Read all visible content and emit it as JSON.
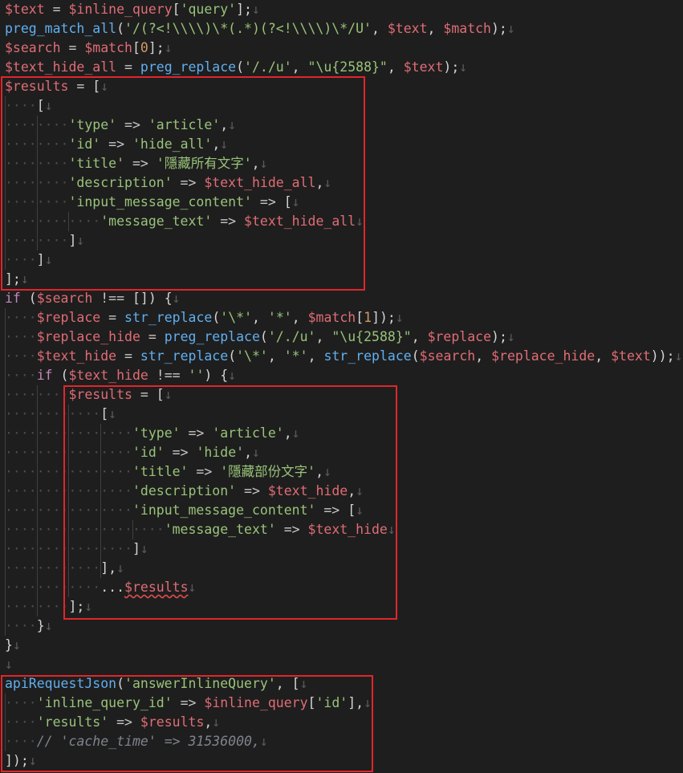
{
  "editor": {
    "whitespace_glyph": "·",
    "eol_glyph": "↓",
    "lines": [
      [
        [
          "var",
          "$text"
        ],
        [
          "op",
          " = "
        ],
        [
          "var",
          "$inline_query"
        ],
        [
          "pun",
          "["
        ],
        [
          "str",
          "'query'"
        ],
        [
          "pun",
          "];"
        ]
      ],
      [
        [
          "fn",
          "preg_match_all"
        ],
        [
          "pun",
          "("
        ],
        [
          "str",
          "'/(?<!\\\\\\\\)\\*(.*)(?<!\\\\\\\\)\\*/U'"
        ],
        [
          "pun",
          ", "
        ],
        [
          "var",
          "$text"
        ],
        [
          "pun",
          ", "
        ],
        [
          "var",
          "$match"
        ],
        [
          "pun",
          ");"
        ]
      ],
      [
        [
          "var",
          "$search"
        ],
        [
          "op",
          " = "
        ],
        [
          "var",
          "$match"
        ],
        [
          "pun",
          "["
        ],
        [
          "num",
          "0"
        ],
        [
          "pun",
          "];"
        ]
      ],
      [
        [
          "var",
          "$text_hide_all"
        ],
        [
          "op",
          " = "
        ],
        [
          "fn",
          "preg_replace"
        ],
        [
          "pun",
          "("
        ],
        [
          "str",
          "'/./u'"
        ],
        [
          "pun",
          ", "
        ],
        [
          "str",
          "\"\\u{2588}\""
        ],
        [
          "pun",
          ", "
        ],
        [
          "var",
          "$text"
        ],
        [
          "pun",
          ");"
        ]
      ],
      [
        [
          "var",
          "$results"
        ],
        [
          "op",
          " = "
        ],
        [
          "pun",
          "["
        ]
      ],
      [
        [
          "ws",
          "····"
        ],
        [
          "pun",
          "["
        ]
      ],
      [
        [
          "ws",
          "········"
        ],
        [
          "str",
          "'type'"
        ],
        [
          "op",
          " => "
        ],
        [
          "str",
          "'article'"
        ],
        [
          "pun",
          ","
        ]
      ],
      [
        [
          "ws",
          "········"
        ],
        [
          "str",
          "'id'"
        ],
        [
          "op",
          " => "
        ],
        [
          "str",
          "'hide_all'"
        ],
        [
          "pun",
          ","
        ]
      ],
      [
        [
          "ws",
          "········"
        ],
        [
          "str",
          "'title'"
        ],
        [
          "op",
          " => "
        ],
        [
          "str",
          "'隱藏所有文字'"
        ],
        [
          "pun",
          ","
        ]
      ],
      [
        [
          "ws",
          "········"
        ],
        [
          "str",
          "'description'"
        ],
        [
          "op",
          " => "
        ],
        [
          "var",
          "$text_hide_all"
        ],
        [
          "pun",
          ","
        ]
      ],
      [
        [
          "ws",
          "········"
        ],
        [
          "str",
          "'input_message_content'"
        ],
        [
          "op",
          " => "
        ],
        [
          "pun",
          "["
        ]
      ],
      [
        [
          "ws",
          "············"
        ],
        [
          "str",
          "'message_text'"
        ],
        [
          "op",
          " => "
        ],
        [
          "var",
          "$text_hide_all"
        ]
      ],
      [
        [
          "ws",
          "········"
        ],
        [
          "pun",
          "]"
        ]
      ],
      [
        [
          "ws",
          "····"
        ],
        [
          "pun",
          "]"
        ]
      ],
      [
        [
          "pun",
          "];"
        ]
      ],
      [
        [
          "kw",
          "if"
        ],
        [
          "pun",
          " ("
        ],
        [
          "var",
          "$search"
        ],
        [
          "op",
          " !== "
        ],
        [
          "pun",
          "[]) {"
        ]
      ],
      [
        [
          "ws",
          "····"
        ],
        [
          "var",
          "$replace"
        ],
        [
          "op",
          " = "
        ],
        [
          "fn",
          "str_replace"
        ],
        [
          "pun",
          "("
        ],
        [
          "str",
          "'\\*'"
        ],
        [
          "pun",
          ", "
        ],
        [
          "str",
          "'*'"
        ],
        [
          "pun",
          ", "
        ],
        [
          "var",
          "$match"
        ],
        [
          "pun",
          "["
        ],
        [
          "num",
          "1"
        ],
        [
          "pun",
          "]);"
        ]
      ],
      [
        [
          "ws",
          "····"
        ],
        [
          "var",
          "$replace_hide"
        ],
        [
          "op",
          " = "
        ],
        [
          "fn",
          "preg_replace"
        ],
        [
          "pun",
          "("
        ],
        [
          "str",
          "'/./u'"
        ],
        [
          "pun",
          ", "
        ],
        [
          "str",
          "\"\\u{2588}\""
        ],
        [
          "pun",
          ", "
        ],
        [
          "var",
          "$replace"
        ],
        [
          "pun",
          ");"
        ]
      ],
      [
        [
          "ws",
          "····"
        ],
        [
          "var",
          "$text_hide"
        ],
        [
          "op",
          " = "
        ],
        [
          "fn",
          "str_replace"
        ],
        [
          "pun",
          "("
        ],
        [
          "str",
          "'\\*'"
        ],
        [
          "pun",
          ", "
        ],
        [
          "str",
          "'*'"
        ],
        [
          "pun",
          ", "
        ],
        [
          "fn",
          "str_replace"
        ],
        [
          "pun",
          "("
        ],
        [
          "var",
          "$search"
        ],
        [
          "pun",
          ", "
        ],
        [
          "var",
          "$replace_hide"
        ],
        [
          "pun",
          ", "
        ],
        [
          "var",
          "$text"
        ],
        [
          "pun",
          "));"
        ]
      ],
      [
        [
          "ws",
          "····"
        ],
        [
          "kw",
          "if"
        ],
        [
          "pun",
          " ("
        ],
        [
          "var",
          "$text_hide"
        ],
        [
          "op",
          " !== "
        ],
        [
          "str",
          "''"
        ],
        [
          "pun",
          ") {"
        ]
      ],
      [
        [
          "ws",
          "········"
        ],
        [
          "var",
          "$results"
        ],
        [
          "op",
          " = "
        ],
        [
          "pun",
          "["
        ]
      ],
      [
        [
          "ws",
          "············"
        ],
        [
          "pun",
          "["
        ]
      ],
      [
        [
          "ws",
          "················"
        ],
        [
          "str",
          "'type'"
        ],
        [
          "op",
          " => "
        ],
        [
          "str",
          "'article'"
        ],
        [
          "pun",
          ","
        ]
      ],
      [
        [
          "ws",
          "················"
        ],
        [
          "str",
          "'id'"
        ],
        [
          "op",
          " => "
        ],
        [
          "str",
          "'hide'"
        ],
        [
          "pun",
          ","
        ]
      ],
      [
        [
          "ws",
          "················"
        ],
        [
          "str",
          "'title'"
        ],
        [
          "op",
          " => "
        ],
        [
          "str",
          "'隱藏部份文字'"
        ],
        [
          "pun",
          ","
        ]
      ],
      [
        [
          "ws",
          "················"
        ],
        [
          "str",
          "'description'"
        ],
        [
          "op",
          " => "
        ],
        [
          "var",
          "$text_hide"
        ],
        [
          "pun",
          ","
        ]
      ],
      [
        [
          "ws",
          "················"
        ],
        [
          "str",
          "'input_message_content'"
        ],
        [
          "op",
          " => "
        ],
        [
          "pun",
          "["
        ]
      ],
      [
        [
          "ws",
          "····················"
        ],
        [
          "str",
          "'message_text'"
        ],
        [
          "op",
          " => "
        ],
        [
          "var",
          "$text_hide"
        ]
      ],
      [
        [
          "ws",
          "················"
        ],
        [
          "pun",
          "]"
        ]
      ],
      [
        [
          "ws",
          "············"
        ],
        [
          "pun",
          "],"
        ]
      ],
      [
        [
          "ws",
          "············"
        ],
        [
          "pun",
          "..."
        ],
        [
          "var squiggle",
          "$results"
        ]
      ],
      [
        [
          "ws",
          "········"
        ],
        [
          "pun",
          "];"
        ]
      ],
      [
        [
          "ws",
          "····"
        ],
        [
          "pun",
          "}"
        ]
      ],
      [
        [
          "pun",
          "}"
        ]
      ],
      [],
      [
        [
          "fn",
          "apiRequestJson"
        ],
        [
          "pun",
          "("
        ],
        [
          "str",
          "'answerInlineQuery'"
        ],
        [
          "pun",
          ", ["
        ]
      ],
      [
        [
          "ws",
          "····"
        ],
        [
          "str",
          "'inline_query_id'"
        ],
        [
          "op",
          " => "
        ],
        [
          "var",
          "$inline_query"
        ],
        [
          "pun",
          "["
        ],
        [
          "str",
          "'id'"
        ],
        [
          "pun",
          "],"
        ]
      ],
      [
        [
          "ws",
          "····"
        ],
        [
          "str",
          "'results'"
        ],
        [
          "op",
          " => "
        ],
        [
          "var",
          "$results"
        ],
        [
          "pun",
          ","
        ]
      ],
      [
        [
          "ws",
          "····"
        ],
        [
          "cmt",
          "// 'cache_time' => 31536000,"
        ]
      ],
      [
        [
          "pun",
          "]);"
        ]
      ]
    ]
  }
}
